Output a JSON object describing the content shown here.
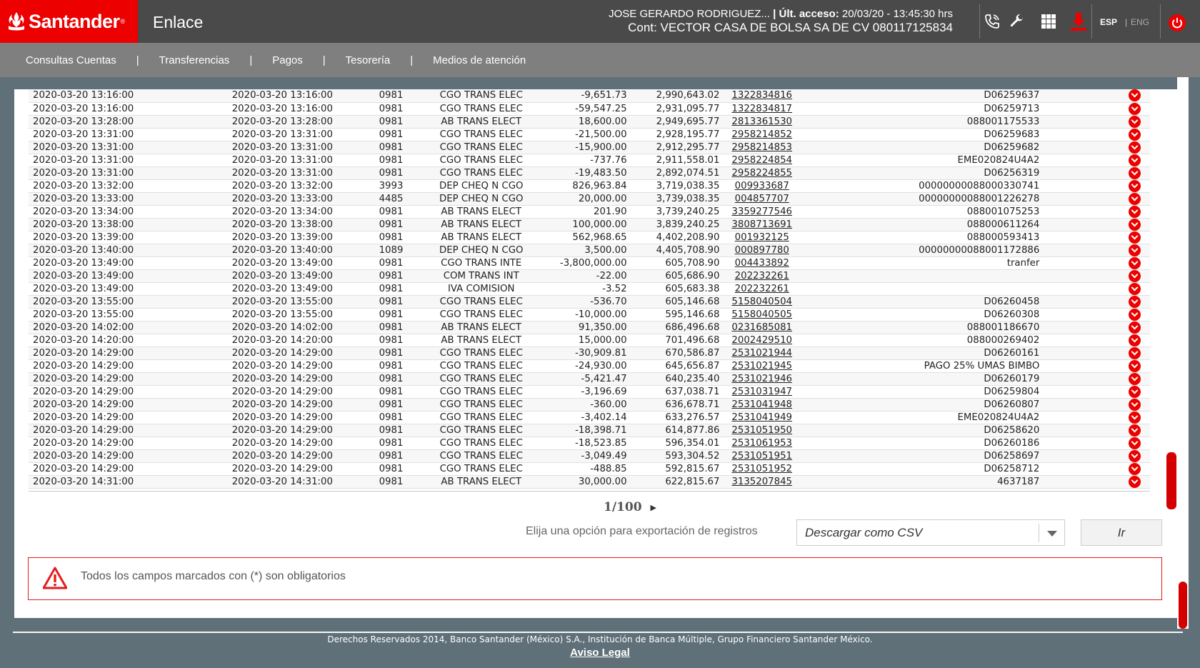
{
  "header": {
    "brand": "Santander",
    "app_name": "Enlace",
    "user_name": "JOSE GERARDO RODRIGUEZ...",
    "last_access_label": "| Últ. acceso:",
    "last_access_value": "20/03/20 - 13:45:30 hrs",
    "contract": "Cont: VECTOR CASA DE BOLSA SA DE CV 080117125834",
    "lang_active": "ESP",
    "lang_inactive": "ENG",
    "brand_color": "#ec0000"
  },
  "nav": {
    "items": [
      {
        "label": "Consultas Cuentas"
      },
      {
        "label": "Transferencias"
      },
      {
        "label": "Pagos"
      },
      {
        "label": "Tesorería"
      },
      {
        "label": "Medios de atención"
      }
    ]
  },
  "table": {
    "rows": [
      {
        "fecha": "2020-03-20 13:16:00",
        "fecha2": "2020-03-20 13:16:00",
        "suc": "0981",
        "desc": "CGO TRANS ELEC",
        "importe": "-9,651.73",
        "saldo": "2,990,643.02",
        "ref": "1322834816",
        "concepto": "D06259637"
      },
      {
        "fecha": "2020-03-20 13:16:00",
        "fecha2": "2020-03-20 13:16:00",
        "suc": "0981",
        "desc": "CGO TRANS ELEC",
        "importe": "-59,547.25",
        "saldo": "2,931,095.77",
        "ref": "1322834817",
        "concepto": "D06259713"
      },
      {
        "fecha": "2020-03-20 13:28:00",
        "fecha2": "2020-03-20 13:28:00",
        "suc": "0981",
        "desc": "AB TRANS ELECT",
        "importe": "18,600.00",
        "saldo": "2,949,695.77",
        "ref": "2813361530",
        "concepto": "088001175533"
      },
      {
        "fecha": "2020-03-20 13:31:00",
        "fecha2": "2020-03-20 13:31:00",
        "suc": "0981",
        "desc": "CGO TRANS ELEC",
        "importe": "-21,500.00",
        "saldo": "2,928,195.77",
        "ref": "2958214852",
        "concepto": "D06259683"
      },
      {
        "fecha": "2020-03-20 13:31:00",
        "fecha2": "2020-03-20 13:31:00",
        "suc": "0981",
        "desc": "CGO TRANS ELEC",
        "importe": "-15,900.00",
        "saldo": "2,912,295.77",
        "ref": "2958214853",
        "concepto": "D06259682"
      },
      {
        "fecha": "2020-03-20 13:31:00",
        "fecha2": "2020-03-20 13:31:00",
        "suc": "0981",
        "desc": "CGO TRANS ELEC",
        "importe": "-737.76",
        "saldo": "2,911,558.01",
        "ref": "2958224854",
        "concepto": "EME020824U4A2"
      },
      {
        "fecha": "2020-03-20 13:31:00",
        "fecha2": "2020-03-20 13:31:00",
        "suc": "0981",
        "desc": "CGO TRANS ELEC",
        "importe": "-19,483.50",
        "saldo": "2,892,074.51",
        "ref": "2958224855",
        "concepto": "D06256319"
      },
      {
        "fecha": "2020-03-20 13:32:00",
        "fecha2": "2020-03-20 13:32:00",
        "suc": "3993",
        "desc": "DEP CHEQ N CGO",
        "importe": "826,963.84",
        "saldo": "3,719,038.35",
        "ref": "009933687",
        "concepto": "00000000088000330741"
      },
      {
        "fecha": "2020-03-20 13:33:00",
        "fecha2": "2020-03-20 13:33:00",
        "suc": "4485",
        "desc": "DEP CHEQ N CGO",
        "importe": "20,000.00",
        "saldo": "3,739,038.35",
        "ref": "004857707",
        "concepto": "00000000088001226278"
      },
      {
        "fecha": "2020-03-20 13:34:00",
        "fecha2": "2020-03-20 13:34:00",
        "suc": "0981",
        "desc": "AB TRANS ELECT",
        "importe": "201.90",
        "saldo": "3,739,240.25",
        "ref": "3359277546",
        "concepto": "088001075253"
      },
      {
        "fecha": "2020-03-20 13:38:00",
        "fecha2": "2020-03-20 13:38:00",
        "suc": "0981",
        "desc": "AB TRANS ELECT",
        "importe": "100,000.00",
        "saldo": "3,839,240.25",
        "ref": "3808713691",
        "concepto": "088000611264"
      },
      {
        "fecha": "2020-03-20 13:39:00",
        "fecha2": "2020-03-20 13:39:00",
        "suc": "0981",
        "desc": "AB TRANS ELECT",
        "importe": "562,968.65",
        "saldo": "4,402,208.90",
        "ref": "001932125",
        "concepto": "088000593413"
      },
      {
        "fecha": "2020-03-20 13:40:00",
        "fecha2": "2020-03-20 13:40:00",
        "suc": "1089",
        "desc": "DEP CHEQ N CGO",
        "importe": "3,500.00",
        "saldo": "4,405,708.90",
        "ref": "000897780",
        "concepto": "00000000088001172886"
      },
      {
        "fecha": "2020-03-20 13:49:00",
        "fecha2": "2020-03-20 13:49:00",
        "suc": "0981",
        "desc": "CGO TRANS INTE",
        "importe": "-3,800,000.00",
        "saldo": "605,708.90",
        "ref": "004433892",
        "concepto": "tranfer"
      },
      {
        "fecha": "2020-03-20 13:49:00",
        "fecha2": "2020-03-20 13:49:00",
        "suc": "0981",
        "desc": "COM TRANS INT",
        "importe": "-22.00",
        "saldo": "605,686.90",
        "ref": "202232261",
        "concepto": ""
      },
      {
        "fecha": "2020-03-20 13:49:00",
        "fecha2": "2020-03-20 13:49:00",
        "suc": "0981",
        "desc": "IVA COMISION",
        "importe": "-3.52",
        "saldo": "605,683.38",
        "ref": "202232261",
        "concepto": ""
      },
      {
        "fecha": "2020-03-20 13:55:00",
        "fecha2": "2020-03-20 13:55:00",
        "suc": "0981",
        "desc": "CGO TRANS ELEC",
        "importe": "-536.70",
        "saldo": "605,146.68",
        "ref": "5158040504",
        "concepto": "D06260458"
      },
      {
        "fecha": "2020-03-20 13:55:00",
        "fecha2": "2020-03-20 13:55:00",
        "suc": "0981",
        "desc": "CGO TRANS ELEC",
        "importe": "-10,000.00",
        "saldo": "595,146.68",
        "ref": "5158040505",
        "concepto": "D06260308"
      },
      {
        "fecha": "2020-03-20 14:02:00",
        "fecha2": "2020-03-20 14:02:00",
        "suc": "0981",
        "desc": "AB TRANS ELECT",
        "importe": "91,350.00",
        "saldo": "686,496.68",
        "ref": "0231685081",
        "concepto": "088001186670"
      },
      {
        "fecha": "2020-03-20 14:20:00",
        "fecha2": "2020-03-20 14:20:00",
        "suc": "0981",
        "desc": "AB TRANS ELECT",
        "importe": "15,000.00",
        "saldo": "701,496.68",
        "ref": "2002429510",
        "concepto": "088000269402"
      },
      {
        "fecha": "2020-03-20 14:29:00",
        "fecha2": "2020-03-20 14:29:00",
        "suc": "0981",
        "desc": "CGO TRANS ELEC",
        "importe": "-30,909.81",
        "saldo": "670,586.87",
        "ref": "2531021944",
        "concepto": "D06260161"
      },
      {
        "fecha": "2020-03-20 14:29:00",
        "fecha2": "2020-03-20 14:29:00",
        "suc": "0981",
        "desc": "CGO TRANS ELEC",
        "importe": "-24,930.00",
        "saldo": "645,656.87",
        "ref": "2531021945",
        "concepto": "PAGO 25% UMAS BIMBO"
      },
      {
        "fecha": "2020-03-20 14:29:00",
        "fecha2": "2020-03-20 14:29:00",
        "suc": "0981",
        "desc": "CGO TRANS ELEC",
        "importe": "-5,421.47",
        "saldo": "640,235.40",
        "ref": "2531021946",
        "concepto": "D06260179"
      },
      {
        "fecha": "2020-03-20 14:29:00",
        "fecha2": "2020-03-20 14:29:00",
        "suc": "0981",
        "desc": "CGO TRANS ELEC",
        "importe": "-3,196.69",
        "saldo": "637,038.71",
        "ref": "2531031947",
        "concepto": "D06259804"
      },
      {
        "fecha": "2020-03-20 14:29:00",
        "fecha2": "2020-03-20 14:29:00",
        "suc": "0981",
        "desc": "CGO TRANS ELEC",
        "importe": "-360.00",
        "saldo": "636,678.71",
        "ref": "2531041948",
        "concepto": "D06260807"
      },
      {
        "fecha": "2020-03-20 14:29:00",
        "fecha2": "2020-03-20 14:29:00",
        "suc": "0981",
        "desc": "CGO TRANS ELEC",
        "importe": "-3,402.14",
        "saldo": "633,276.57",
        "ref": "2531041949",
        "concepto": "EME020824U4A2"
      },
      {
        "fecha": "2020-03-20 14:29:00",
        "fecha2": "2020-03-20 14:29:00",
        "suc": "0981",
        "desc": "CGO TRANS ELEC",
        "importe": "-18,398.71",
        "saldo": "614,877.86",
        "ref": "2531051950",
        "concepto": "D06258620"
      },
      {
        "fecha": "2020-03-20 14:29:00",
        "fecha2": "2020-03-20 14:29:00",
        "suc": "0981",
        "desc": "CGO TRANS ELEC",
        "importe": "-18,523.85",
        "saldo": "596,354.01",
        "ref": "2531061953",
        "concepto": "D06260186"
      },
      {
        "fecha": "2020-03-20 14:29:00",
        "fecha2": "2020-03-20 14:29:00",
        "suc": "0981",
        "desc": "CGO TRANS ELEC",
        "importe": "-3,049.49",
        "saldo": "593,304.52",
        "ref": "2531051951",
        "concepto": "D06258697"
      },
      {
        "fecha": "2020-03-20 14:29:00",
        "fecha2": "2020-03-20 14:29:00",
        "suc": "0981",
        "desc": "CGO TRANS ELEC",
        "importe": "-488.85",
        "saldo": "592,815.67",
        "ref": "2531051952",
        "concepto": "D06258712"
      },
      {
        "fecha": "2020-03-20 14:31:00",
        "fecha2": "2020-03-20 14:31:00",
        "suc": "0981",
        "desc": "AB TRANS ELECT",
        "importe": "30,000.00",
        "saldo": "622,815.67",
        "ref": "3135207845",
        "concepto": "4637187"
      }
    ]
  },
  "pager": {
    "text": "1/100"
  },
  "export": {
    "label": "Elija una opción para exportación de registros",
    "selected": "Descargar como CSV",
    "button": "Ir"
  },
  "alert": {
    "message": "Todos los campos marcados con (*) son obligatorios"
  },
  "footer": {
    "copyright": "Derechos Reservados 2014, Banco Santander (México) S.A., Institución de Banca Múltiple, Grupo Financiero Santander México.",
    "legal_link": "Aviso Legal"
  }
}
